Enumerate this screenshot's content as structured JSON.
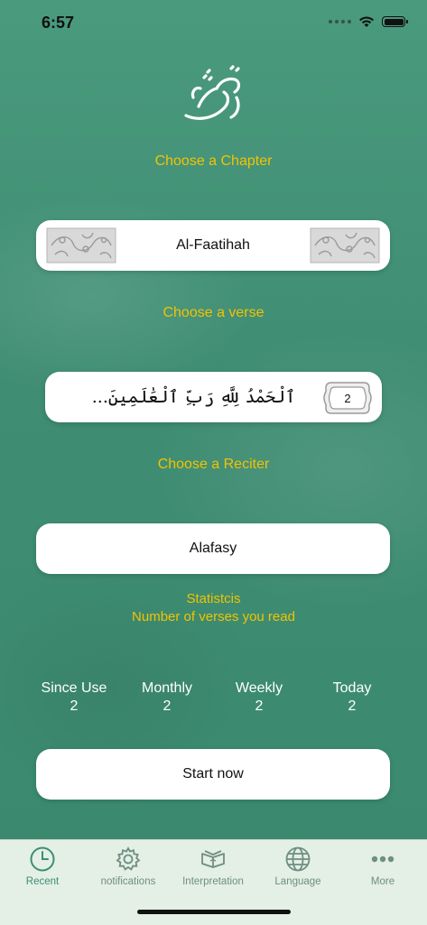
{
  "status": {
    "time": "6:57"
  },
  "app": {
    "logo_text": "نختم"
  },
  "chapter": {
    "label": "Choose a Chapter",
    "value": "Al-Faatihah"
  },
  "verse": {
    "label": "Choose a verse",
    "text": "ٱلْحَمْدُ لِلَّهِ رَبِّ ٱلْعَٰلَمِينَ...",
    "number": "2"
  },
  "reciter": {
    "label": "Choose a Reciter",
    "value": "Alafasy"
  },
  "stats": {
    "title": "Statistcis",
    "subtitle": "Number of verses you read",
    "items": [
      {
        "label": "Since Use",
        "value": "2"
      },
      {
        "label": "Monthly",
        "value": "2"
      },
      {
        "label": "Weekly",
        "value": "2"
      },
      {
        "label": "Today",
        "value": "2"
      }
    ]
  },
  "start_button": {
    "label": "Start now"
  },
  "tabs": [
    {
      "label": "Recent",
      "icon": "clock-icon",
      "active": true
    },
    {
      "label": "notifications",
      "icon": "gear-icon"
    },
    {
      "label": "Interpretation",
      "icon": "quran-book-icon"
    },
    {
      "label": "Language",
      "icon": "globe-icon"
    },
    {
      "label": "More",
      "icon": "more-icon"
    }
  ],
  "colors": {
    "background": "#3f8e74",
    "accent": "#f2c300",
    "tab_active": "#3a8f74",
    "tab_inactive": "#6e8f82"
  }
}
